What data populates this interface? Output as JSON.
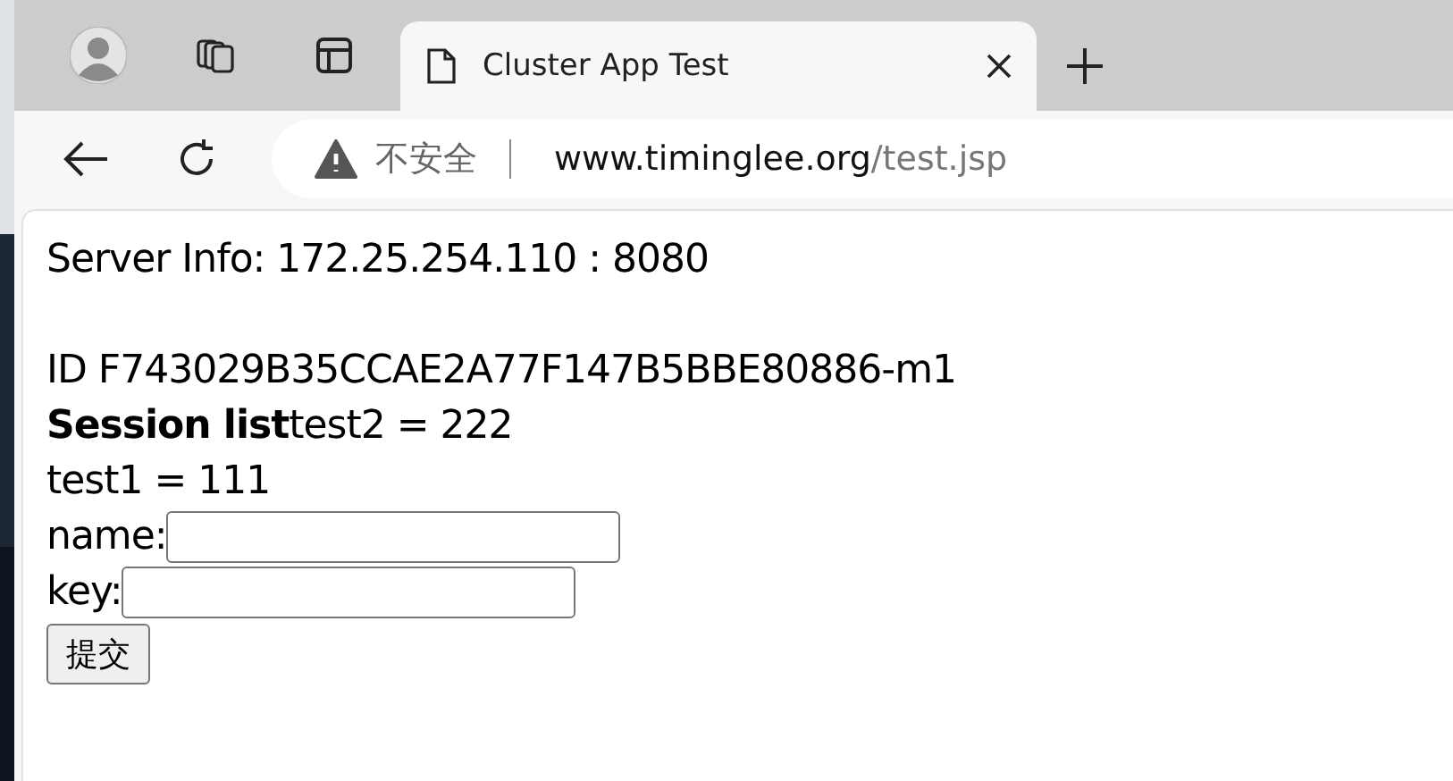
{
  "browser": {
    "tab": {
      "title": "Cluster App Test",
      "selected": true
    },
    "address_bar": {
      "security_label": "不安全",
      "host": "www.timinglee.org",
      "path": "/test.jsp"
    }
  },
  "page": {
    "server_info": "Server Info: 172.25.254.110 : 8080",
    "session_id": "ID F743029B35CCAE2A77F147B5BBE80886-m1",
    "session_list": "**Session list**test2 = 222",
    "lines": [
      "test1 = 111"
    ],
    "fields": [
      {
        "label": "name:"
      },
      {
        "label": "key:"
      }
    ],
    "submit_button": "提交"
  }
}
